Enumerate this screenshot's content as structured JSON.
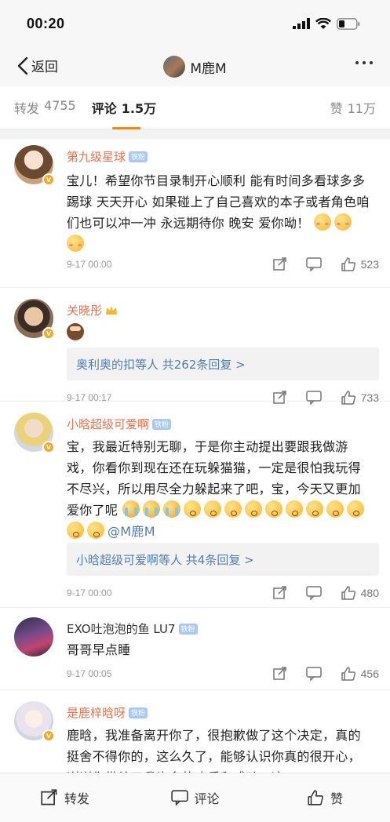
{
  "status": {
    "time": "00:20"
  },
  "nav": {
    "back_label": "返回",
    "title": "M鹿M"
  },
  "tabs": {
    "repost_label": "转发",
    "repost_count": "4755",
    "comment_label": "评论",
    "comment_count": "1.5万",
    "like_label": "赞",
    "like_count": "11万"
  },
  "comments": [
    {
      "user": "第九级星球",
      "badge": "铁粉",
      "text": "宝儿！希望你节目录制开心顺利 能有时间多看球多多踢球 天天开心 如果碰上了自己喜欢的本子或者角色咱们也可以冲一冲 永远期待你 晚安 爱你呦！",
      "time": "9-17 00:00",
      "likes": "523"
    },
    {
      "user": "关晓彤",
      "replies_text": "奥利奥的扣等人 共262条回复 >",
      "time": "9-17 00:17",
      "likes": "733"
    },
    {
      "user": "小晗超级可爱啊",
      "badge": "铁粉",
      "text": "宝，我最近特别无聊，于是你主动提出要跟我做游戏，你看你到现在还在玩躲猫猫，一定是很怕我玩得不尽兴，所以用尽全力躲起来了吧，宝，今天又更加爱你了呢",
      "mention": "@M鹿M",
      "replies_text": "小晗超级可爱啊等人 共4条回复 >",
      "time": "9-17 00:00",
      "likes": "480"
    },
    {
      "user": "EXO吐泡泡的鱼 LU7",
      "badge": "铁粉",
      "text": "哥哥早点睡",
      "time": "9-17 00:05",
      "likes": "456"
    },
    {
      "user": "是鹿梓晗呀",
      "badge": "铁粉",
      "text": "鹿晗，我准备离开你了，很抱歉做了这个决定，真的挺舍不得你的，这么久了，能够认识你真的很开心，谢谢你带给了我许多的欢乐和感动，这"
    }
  ],
  "bottom": {
    "repost_label": "转发",
    "comment_label": "评论",
    "like_label": "赞"
  },
  "colors": {
    "accent": "#ff8200",
    "username": "#eb7350",
    "link": "#507daf"
  }
}
